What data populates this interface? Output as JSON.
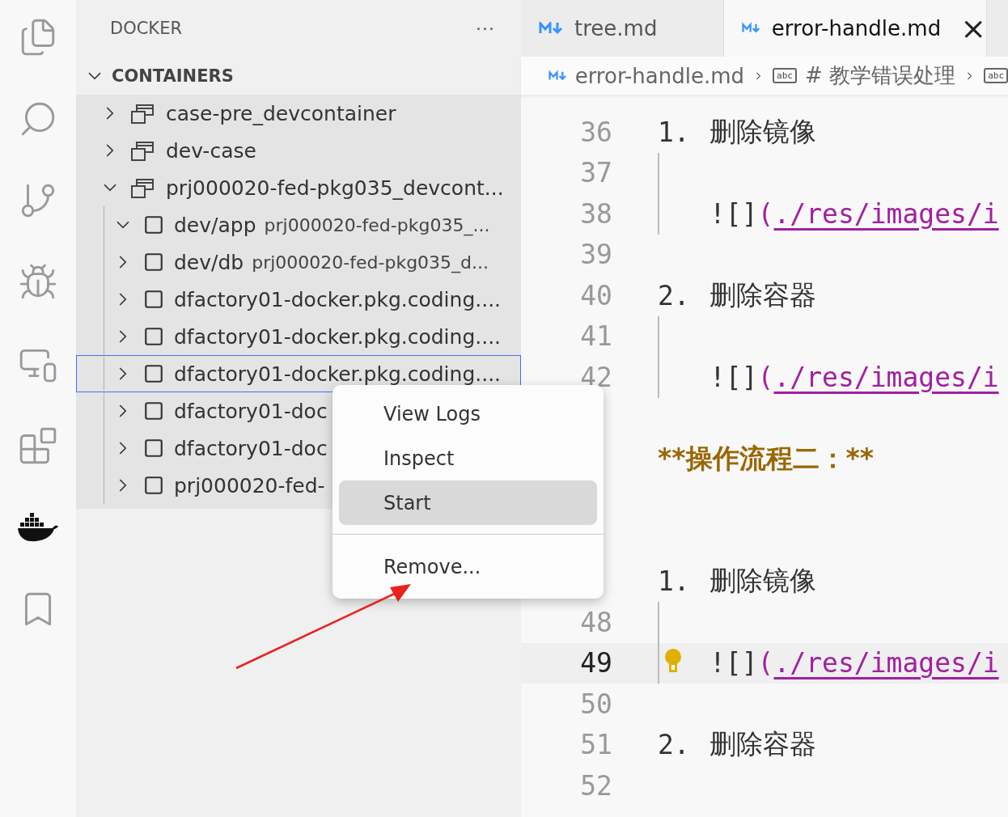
{
  "activity_bar": [
    {
      "kind": "files",
      "selected": false
    },
    {
      "kind": "search",
      "selected": false
    },
    {
      "kind": "scm",
      "selected": false
    },
    {
      "kind": "debug",
      "selected": false
    },
    {
      "kind": "remote",
      "selected": false
    },
    {
      "kind": "extensions",
      "selected": false
    },
    {
      "kind": "docker",
      "selected": true
    },
    {
      "kind": "bookmark",
      "selected": false
    }
  ],
  "sidebar": {
    "title": "DOCKER",
    "more": "···",
    "section": {
      "title": "CONTAINERS",
      "expanded": true,
      "items": [
        {
          "label": "case-pre_devcontainer",
          "expanded": false
        },
        {
          "label": "dev-case",
          "expanded": false
        },
        {
          "label": "prj000020-fed-pkg035_devcont...",
          "expanded": true,
          "children": [
            {
              "label": "dev/app",
              "description": "prj000020-fed-pkg035_...",
              "expanded": true,
              "selected": false
            },
            {
              "label": "dev/db",
              "description": "prj000020-fed-pkg035_d...",
              "expanded": false,
              "selected": false
            },
            {
              "label": "dfactory01-docker.pkg.coding....",
              "expanded": false,
              "selected": false
            },
            {
              "label": "dfactory01-docker.pkg.coding....",
              "expanded": false,
              "selected": false
            },
            {
              "label": "dfactory01-docker.pkg.coding....",
              "expanded": false,
              "selected": true
            },
            {
              "label": "dfactory01-doc",
              "expanded": false,
              "selected": false
            },
            {
              "label": "dfactory01-doc",
              "expanded": false,
              "selected": false
            },
            {
              "label": "prj000020-fed-",
              "expanded": false,
              "selected": false
            }
          ]
        }
      ]
    }
  },
  "tabs": [
    {
      "label": "tree.md",
      "selected": false
    },
    {
      "label": "error-handle.md",
      "selected": true,
      "close": "×"
    }
  ],
  "breadcrumb": [
    {
      "kind": "file",
      "label": "error-handle.md"
    },
    {
      "kind": "symbol",
      "icon_text": "abc",
      "label": "# 教学错误处理"
    },
    {
      "kind": "symbol",
      "icon_text": "abc"
    }
  ],
  "editor": {
    "lines": [
      {
        "number": "36",
        "kind": "list",
        "marker": "1.",
        "text": "删除镜像"
      },
      {
        "number": "37",
        "kind": "empty",
        "guide": true
      },
      {
        "number": "38",
        "kind": "image",
        "guide": true,
        "prefix": "![]",
        "paren": "(",
        "link": "./res/images/i"
      },
      {
        "number": "39",
        "kind": "empty"
      },
      {
        "number": "40",
        "kind": "list",
        "marker": "2.",
        "text": "删除容器"
      },
      {
        "number": "41",
        "kind": "empty",
        "guide": true
      },
      {
        "number": "42",
        "kind": "image",
        "guide": true,
        "prefix": "![]",
        "paren": "(",
        "link": "./res/images/i"
      },
      {
        "kind": "empty"
      },
      {
        "kind": "bold",
        "text": "**操作流程二：**"
      },
      {
        "kind": "empty"
      },
      {
        "kind": "empty"
      },
      {
        "kind": "list",
        "marker": "1.",
        "text": "删除镜像"
      },
      {
        "number": "48",
        "kind": "empty",
        "guide": true
      },
      {
        "number": "49",
        "kind": "image",
        "guide": true,
        "current": true,
        "prefix": "![]",
        "paren": "(",
        "link": "./res/images/i"
      },
      {
        "number": "50",
        "kind": "empty"
      },
      {
        "number": "51",
        "kind": "list",
        "marker": "2.",
        "text": "删除容器"
      },
      {
        "number": "52",
        "kind": "empty"
      }
    ]
  },
  "context_menu": [
    {
      "kind": "item",
      "label": "View Logs",
      "selected": false
    },
    {
      "kind": "item",
      "label": "Inspect",
      "selected": false
    },
    {
      "kind": "item",
      "label": "Start",
      "selected": true
    },
    {
      "kind": "separator"
    },
    {
      "kind": "item",
      "label": "Remove...",
      "selected": false
    }
  ]
}
